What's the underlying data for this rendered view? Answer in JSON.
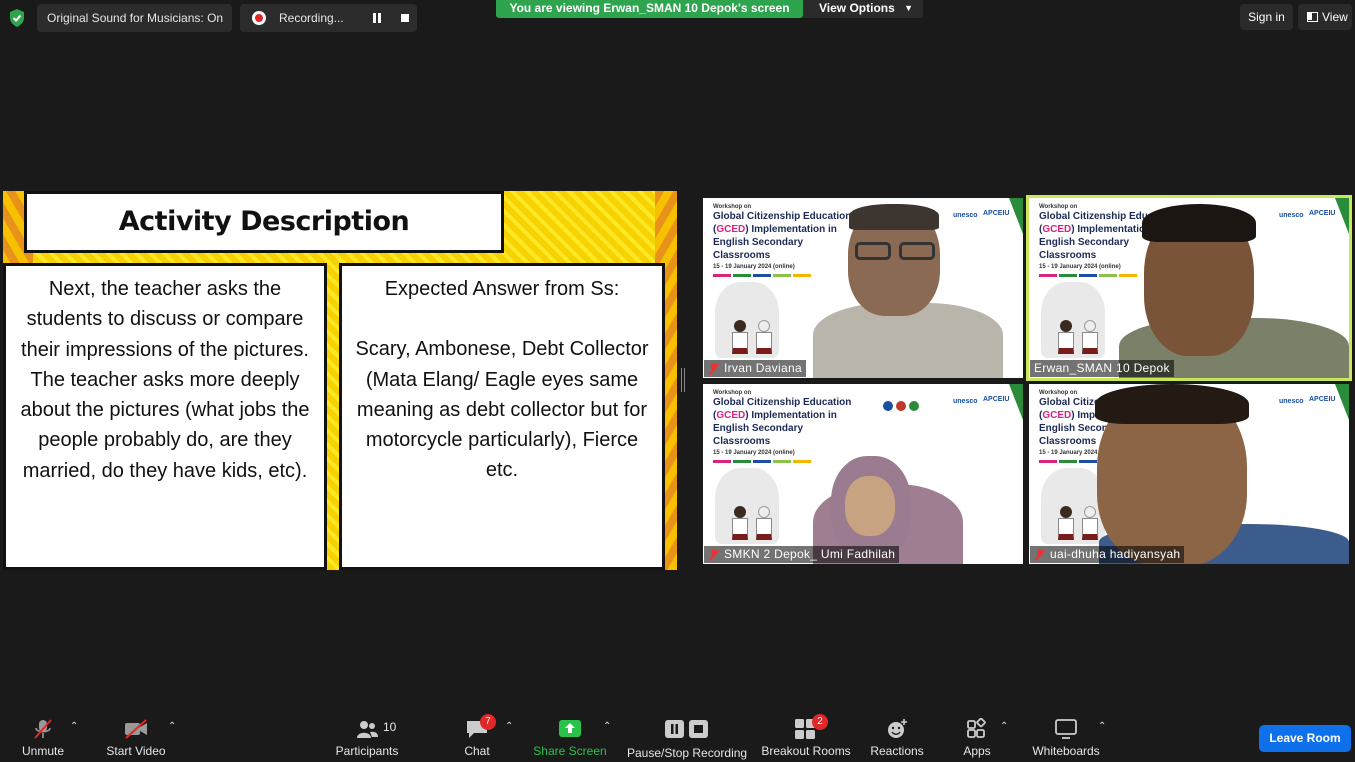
{
  "topbar": {
    "original_sound": "Original Sound for Musicians: On",
    "recording": "Recording...",
    "viewing_banner": "You are viewing Erwan_SMAN 10 Depok's screen",
    "view_options": "View Options",
    "sign_in": "Sign in",
    "view": "View"
  },
  "slide": {
    "title": "Activity Description",
    "left_text": "Next, the teacher asks the students to discuss or compare their impressions of the pictures. The teacher asks more deeply about the pictures (what jobs the people probably do, are they married, do they have kids, etc).",
    "right_heading": "Expected Answer from Ss:",
    "right_text": "Scary, Ambonese, Debt Collector (Mata Elang/ Eagle eyes same meaning as debt collector but for motorcycle particularly), Fierce etc."
  },
  "virtual_background": {
    "workshop_on": "Workshop on",
    "title_line1": "Global Citizenship Education",
    "title_line2_prefix": "(",
    "title_line2_gced": "GCED",
    "title_line2_suffix": ") Implementation in",
    "title_line3": "English Secondary",
    "title_line4": "Classrooms",
    "dates": "15 - 19 January 2024 (online)",
    "unesco": "unesco",
    "apceiu": "APCEIU"
  },
  "participants_tiles": [
    {
      "name": "Irvan Daviana",
      "muted": true
    },
    {
      "name": "Erwan_SMAN 10 Depok",
      "muted": false,
      "active_speaker": true
    },
    {
      "name": "SMKN 2 Depok_ Umi Fadhilah",
      "muted": true
    },
    {
      "name": "uai-dhuha hadiyansyah",
      "muted": true
    }
  ],
  "toolbar": {
    "unmute": "Unmute",
    "start_video": "Start Video",
    "participants_count": "10",
    "participants": "Participants",
    "chat": "Chat",
    "chat_badge": "7",
    "share_screen": "Share Screen",
    "pause_stop_recording": "Pause/Stop Recording",
    "breakout_rooms": "Breakout Rooms",
    "breakout_badge": "2",
    "reactions": "Reactions",
    "apps": "Apps",
    "whiteboards": "Whiteboards",
    "leave_room": "Leave Room"
  },
  "colors": {
    "accent_green": "#2ea44f",
    "leave_blue": "#0e71eb",
    "badge_red": "#e02828",
    "active_speaker": "#c7e85a",
    "slide_yellow": "#f7d600"
  },
  "icons": [
    "shield-icon",
    "record-icon",
    "pause-icon",
    "stop-icon",
    "view-icon",
    "mic-muted-icon",
    "video-off-icon",
    "participants-icon",
    "chat-icon",
    "share-screen-icon",
    "recording-controls-icon",
    "breakout-rooms-icon",
    "reactions-icon",
    "apps-icon",
    "whiteboard-icon"
  ]
}
